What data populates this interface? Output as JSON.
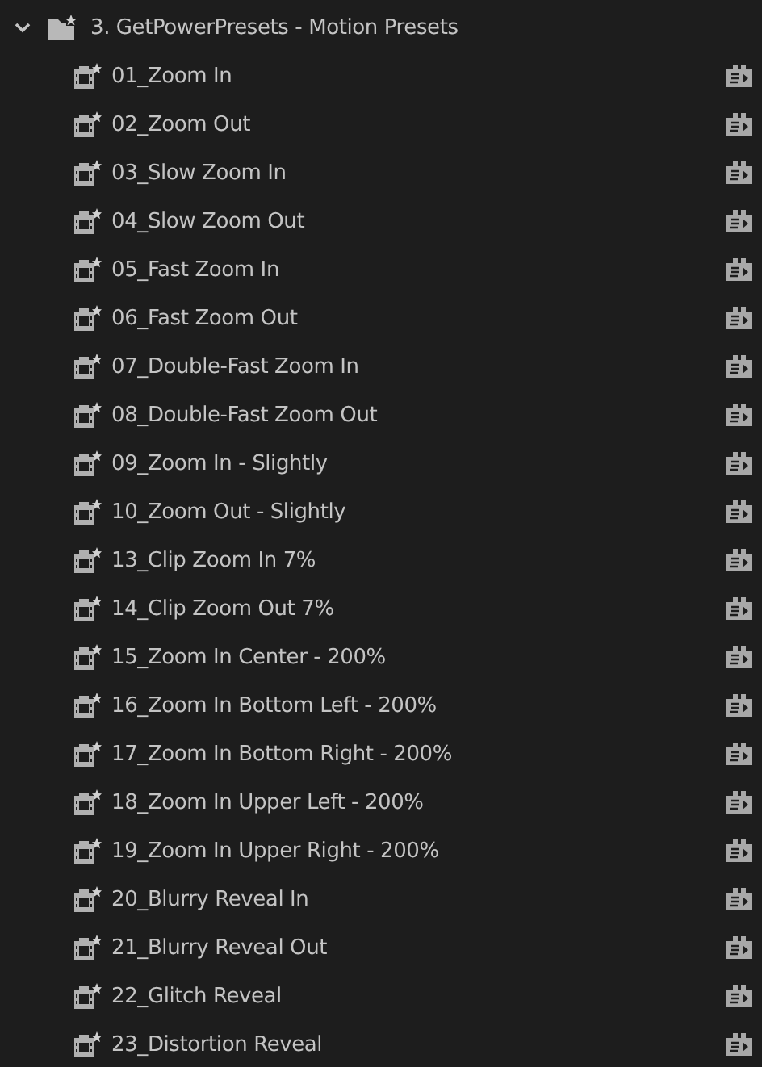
{
  "folder": {
    "title": "3. GetPowerPresets - Motion Presets",
    "expanded": true,
    "children": [
      {
        "label": "01_Zoom In"
      },
      {
        "label": "02_Zoom Out"
      },
      {
        "label": "03_Slow Zoom In"
      },
      {
        "label": "04_Slow Zoom Out"
      },
      {
        "label": "05_Fast Zoom In"
      },
      {
        "label": "06_Fast Zoom Out"
      },
      {
        "label": "07_Double-Fast Zoom In"
      },
      {
        "label": "08_Double-Fast Zoom Out"
      },
      {
        "label": "09_Zoom In - Slightly"
      },
      {
        "label": "10_Zoom Out - Slightly"
      },
      {
        "label": "13_Clip Zoom In 7%"
      },
      {
        "label": "14_Clip Zoom Out 7%"
      },
      {
        "label": "15_Zoom In Center - 200%"
      },
      {
        "label": "16_Zoom In Bottom Left - 200%"
      },
      {
        "label": "17_Zoom In Bottom Right - 200%"
      },
      {
        "label": "18_Zoom In Upper Left - 200%"
      },
      {
        "label": "19_Zoom In Upper Right - 200%"
      },
      {
        "label": "20_Blurry Reveal In"
      },
      {
        "label": "21_Blurry Reveal Out"
      },
      {
        "label": "22_Glitch Reveal"
      },
      {
        "label": "23_Distortion Reveal"
      }
    ]
  }
}
